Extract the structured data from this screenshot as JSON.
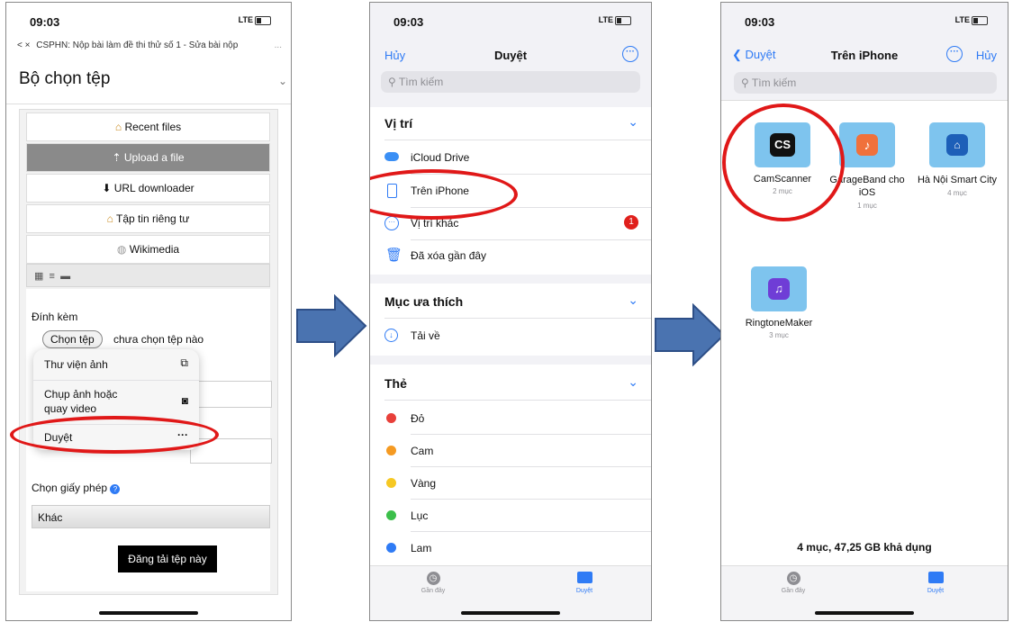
{
  "common": {
    "time": "09:03",
    "signal": "LTE"
  },
  "phone1": {
    "url_close": "<  ×",
    "url_title": "CSPHN: Nộp bài làm đề thi thử số 1 - Sửa bài nộp",
    "url_more": "...",
    "heading": "Bộ chọn tệp",
    "repos": [
      "Recent files",
      "Upload a file",
      "URL downloader",
      "Tập tin riêng tư",
      "Wikimedia"
    ],
    "attach_label": "Đính kèm",
    "choose_btn": "Chọn tệp",
    "no_file": "chưa chọn tệp nào",
    "popup": [
      "Thư viện ảnh",
      "Chụp ảnh hoặc quay video",
      "Duyệt"
    ],
    "license_label": "Chọn giấy phép",
    "license_value": "Khác",
    "upload_btn": "Đăng tải tệp này"
  },
  "phone2": {
    "cancel": "Hủy",
    "title": "Duyệt",
    "search": "Tìm kiếm",
    "locations_title": "Vị trí",
    "locations": [
      "iCloud Drive",
      "Trên iPhone",
      "Vị trí khác",
      "Đã xóa gần đây"
    ],
    "badge": "1",
    "favorites_title": "Mục ưa thích",
    "favorites": [
      "Tải về"
    ],
    "tags_title": "Thẻ",
    "tags": [
      {
        "name": "Đỏ",
        "color": "#e8403a"
      },
      {
        "name": "Cam",
        "color": "#f59a22"
      },
      {
        "name": "Vàng",
        "color": "#f6c823"
      },
      {
        "name": "Lục",
        "color": "#3bbf4a"
      },
      {
        "name": "Lam",
        "color": "#2f7bf5"
      }
    ],
    "tab_recent": "Gần đây",
    "tab_browse": "Duyệt"
  },
  "phone3": {
    "back": "Duyệt",
    "title": "Trên iPhone",
    "cancel": "Hủy",
    "search": "Tìm kiếm",
    "folders": [
      {
        "name": "CamScanner",
        "count": "2 mục"
      },
      {
        "name": "GarageBand cho iOS",
        "count": "1 mục"
      },
      {
        "name": "Hà Nội Smart City",
        "count": "4 mục"
      },
      {
        "name": "RingtoneMaker",
        "count": "3 mục"
      }
    ],
    "footer": "4 mục, 47,25 GB khả dụng",
    "tab_recent": "Gần đây",
    "tab_browse": "Duyệt"
  },
  "colors": {
    "accent": "#2f7bf5",
    "arrow": "#4a73b0",
    "ring": "#e01818",
    "upload_selected": "#8a8a8a"
  }
}
